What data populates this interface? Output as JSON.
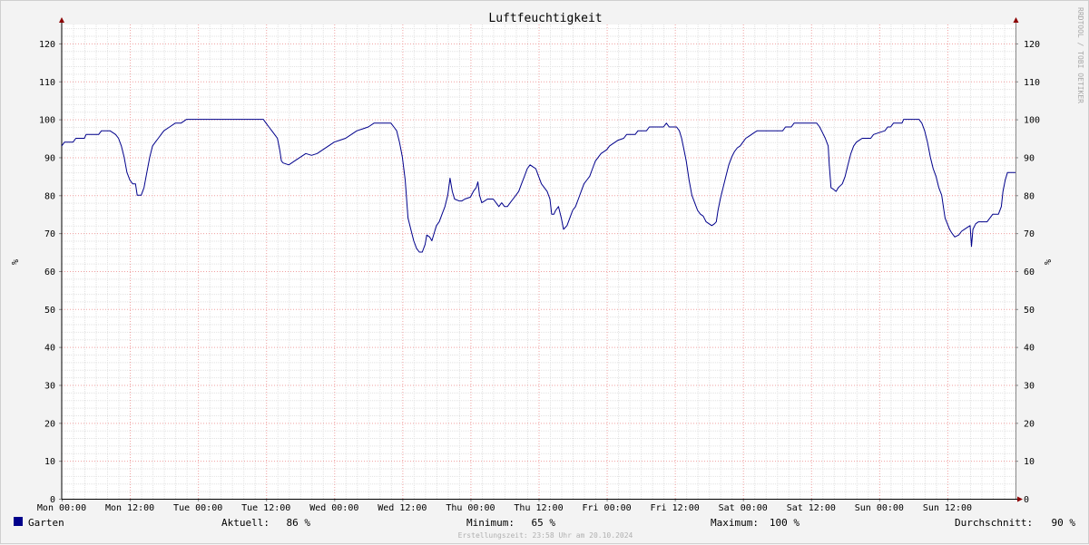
{
  "chart_data": {
    "type": "line",
    "title": "Luftfeuchtigkeit",
    "ylabel": "%",
    "xlabel": "",
    "ylim": [
      0,
      125
    ],
    "xlim": [
      0,
      168
    ],
    "x_unit": "hours since Mon 00:00",
    "y_ticks": [
      0,
      10,
      20,
      30,
      40,
      50,
      60,
      70,
      80,
      90,
      100,
      110,
      120
    ],
    "x_ticks": [
      {
        "x": 0,
        "label": "Mon 00:00"
      },
      {
        "x": 12,
        "label": "Mon 12:00"
      },
      {
        "x": 24,
        "label": "Tue 00:00"
      },
      {
        "x": 36,
        "label": "Tue 12:00"
      },
      {
        "x": 48,
        "label": "Wed 00:00"
      },
      {
        "x": 60,
        "label": "Wed 12:00"
      },
      {
        "x": 72,
        "label": "Thu 00:00"
      },
      {
        "x": 84,
        "label": "Thu 12:00"
      },
      {
        "x": 96,
        "label": "Fri 00:00"
      },
      {
        "x": 108,
        "label": "Fri 12:00"
      },
      {
        "x": 120,
        "label": "Sat 00:00"
      },
      {
        "x": 132,
        "label": "Sat 12:00"
      },
      {
        "x": 144,
        "label": "Sun 00:00"
      },
      {
        "x": 156,
        "label": "Sun 12:00"
      }
    ],
    "grid": true,
    "legend": "bottom-left",
    "series": [
      {
        "name": "Garten",
        "color": "#00008b",
        "points": [
          [
            0,
            93
          ],
          [
            0.5,
            94
          ],
          [
            2,
            94
          ],
          [
            2.5,
            95
          ],
          [
            4,
            95
          ],
          [
            4.3,
            96
          ],
          [
            6.5,
            96
          ],
          [
            7,
            97
          ],
          [
            8.5,
            97
          ],
          [
            9.5,
            96
          ],
          [
            10,
            95
          ],
          [
            10.5,
            93
          ],
          [
            11,
            90
          ],
          [
            11.5,
            86
          ],
          [
            12,
            84
          ],
          [
            12.5,
            83
          ],
          [
            13,
            83
          ],
          [
            13.3,
            80
          ],
          [
            14,
            80
          ],
          [
            14.5,
            82
          ],
          [
            15,
            86
          ],
          [
            15.5,
            90
          ],
          [
            16,
            93
          ],
          [
            16.5,
            94
          ],
          [
            17,
            95
          ],
          [
            17.5,
            96
          ],
          [
            18,
            97
          ],
          [
            19,
            98
          ],
          [
            20,
            99
          ],
          [
            21,
            99
          ],
          [
            22,
            100
          ],
          [
            35,
            100
          ],
          [
            35.5,
            100
          ],
          [
            36,
            99
          ],
          [
            36.5,
            98
          ],
          [
            37,
            97
          ],
          [
            37.5,
            96
          ],
          [
            38,
            95
          ],
          [
            38.4,
            92
          ],
          [
            38.7,
            89
          ],
          [
            39,
            88.5
          ],
          [
            40,
            88
          ],
          [
            40.5,
            88.5
          ],
          [
            41,
            89
          ],
          [
            42,
            90
          ],
          [
            43,
            91
          ],
          [
            44,
            90.5
          ],
          [
            45,
            91
          ],
          [
            46,
            92
          ],
          [
            47,
            93
          ],
          [
            48,
            94
          ],
          [
            49,
            94.5
          ],
          [
            50,
            95
          ],
          [
            51,
            96
          ],
          [
            52,
            97
          ],
          [
            53,
            97.5
          ],
          [
            54,
            98
          ],
          [
            55,
            99
          ],
          [
            56,
            99
          ],
          [
            57,
            99
          ],
          [
            58,
            99
          ],
          [
            58.5,
            98
          ],
          [
            59,
            97
          ],
          [
            59.5,
            94
          ],
          [
            60,
            90
          ],
          [
            60.5,
            84
          ],
          [
            61,
            74
          ],
          [
            61.5,
            71
          ],
          [
            62,
            68
          ],
          [
            62.5,
            66
          ],
          [
            63,
            65
          ],
          [
            63.5,
            65
          ],
          [
            64,
            67
          ],
          [
            64.3,
            69.5
          ],
          [
            64.8,
            69
          ],
          [
            65.2,
            68
          ],
          [
            65.6,
            70
          ],
          [
            66,
            72
          ],
          [
            66.5,
            73
          ],
          [
            67,
            75
          ],
          [
            67.5,
            77
          ],
          [
            68,
            80
          ],
          [
            68.4,
            84.5
          ],
          [
            68.8,
            81
          ],
          [
            69.2,
            79
          ],
          [
            70,
            78.5
          ],
          [
            70.5,
            78.5
          ],
          [
            71,
            79
          ],
          [
            72,
            79.5
          ],
          [
            72.5,
            81
          ],
          [
            73,
            82
          ],
          [
            73.3,
            83.5
          ],
          [
            73.6,
            80
          ],
          [
            74,
            78
          ],
          [
            74.5,
            78.5
          ],
          [
            75,
            79
          ],
          [
            76,
            79
          ],
          [
            76.5,
            78
          ],
          [
            77,
            77
          ],
          [
            77.5,
            78
          ],
          [
            78,
            77
          ],
          [
            78.5,
            77
          ],
          [
            79,
            78
          ],
          [
            79.5,
            79
          ],
          [
            80,
            80
          ],
          [
            80.5,
            81
          ],
          [
            81,
            83
          ],
          [
            81.5,
            85
          ],
          [
            82,
            87
          ],
          [
            82.5,
            88
          ],
          [
            83,
            87.5
          ],
          [
            83.5,
            87
          ],
          [
            84,
            85
          ],
          [
            84.5,
            83
          ],
          [
            85,
            82
          ],
          [
            85.5,
            81
          ],
          [
            86,
            79
          ],
          [
            86.3,
            75
          ],
          [
            86.7,
            75
          ],
          [
            87,
            76
          ],
          [
            87.5,
            77
          ],
          [
            88,
            74
          ],
          [
            88.4,
            71
          ],
          [
            89,
            72
          ],
          [
            89.5,
            74
          ],
          [
            90,
            76
          ],
          [
            90.5,
            77
          ],
          [
            91,
            79
          ],
          [
            91.5,
            81
          ],
          [
            92,
            83
          ],
          [
            92.5,
            84
          ],
          [
            93,
            85
          ],
          [
            93.5,
            87
          ],
          [
            94,
            89
          ],
          [
            94.5,
            90
          ],
          [
            95,
            91
          ],
          [
            96,
            92
          ],
          [
            96.5,
            93
          ],
          [
            97,
            93.5
          ],
          [
            98,
            94.5
          ],
          [
            99,
            95
          ],
          [
            99.5,
            96
          ],
          [
            101,
            96
          ],
          [
            101.5,
            97
          ],
          [
            103,
            97
          ],
          [
            103.5,
            98
          ],
          [
            106,
            98
          ],
          [
            106.5,
            99
          ],
          [
            107,
            98
          ],
          [
            108.3,
            98
          ],
          [
            108.8,
            97
          ],
          [
            109.2,
            95
          ],
          [
            109.6,
            92
          ],
          [
            110,
            89
          ],
          [
            110.5,
            84
          ],
          [
            111,
            80
          ],
          [
            111.5,
            78
          ],
          [
            112,
            76
          ],
          [
            112.5,
            75
          ],
          [
            113,
            74.5
          ],
          [
            113.5,
            73
          ],
          [
            114,
            72.5
          ],
          [
            114.5,
            72
          ],
          [
            115,
            72.5
          ],
          [
            115.3,
            73
          ],
          [
            115.6,
            76
          ],
          [
            116,
            79
          ],
          [
            116.5,
            82
          ],
          [
            117,
            85
          ],
          [
            117.5,
            88
          ],
          [
            118,
            90
          ],
          [
            118.5,
            91.5
          ],
          [
            119,
            92.5
          ],
          [
            119.5,
            93
          ],
          [
            120,
            94
          ],
          [
            120.5,
            95
          ],
          [
            121,
            95.5
          ],
          [
            121.5,
            96
          ],
          [
            122,
            96.5
          ],
          [
            122.5,
            97
          ],
          [
            127,
            97
          ],
          [
            127.5,
            98
          ],
          [
            128.5,
            98
          ],
          [
            129,
            99
          ],
          [
            133,
            99
          ],
          [
            133.5,
            98
          ],
          [
            134,
            96.5
          ],
          [
            134.5,
            95
          ],
          [
            135,
            93
          ],
          [
            135.2,
            88
          ],
          [
            135.5,
            82
          ],
          [
            136,
            81.5
          ],
          [
            136.4,
            81
          ],
          [
            136.8,
            82
          ],
          [
            137.5,
            83
          ],
          [
            138,
            85
          ],
          [
            138.5,
            88
          ],
          [
            139,
            91
          ],
          [
            139.5,
            93
          ],
          [
            140,
            94
          ],
          [
            140.5,
            94.5
          ],
          [
            141,
            95
          ],
          [
            142.5,
            95
          ],
          [
            143,
            96
          ],
          [
            144,
            96.5
          ],
          [
            145,
            97
          ],
          [
            145.5,
            98
          ],
          [
            146,
            98
          ],
          [
            146.5,
            99
          ],
          [
            148,
            99
          ],
          [
            148.3,
            100
          ],
          [
            151,
            100
          ],
          [
            151.5,
            99
          ],
          [
            152,
            97
          ],
          [
            152.5,
            94
          ],
          [
            153,
            90
          ],
          [
            153.5,
            87
          ],
          [
            154,
            85
          ],
          [
            154.5,
            82
          ],
          [
            155,
            80
          ],
          [
            155.3,
            77
          ],
          [
            155.6,
            74
          ],
          [
            156,
            72.5
          ],
          [
            156.4,
            71
          ],
          [
            156.8,
            70
          ],
          [
            157.3,
            69
          ],
          [
            158,
            69.5
          ],
          [
            158.5,
            70.5
          ],
          [
            159,
            71
          ],
          [
            159.5,
            71.5
          ],
          [
            160,
            72
          ],
          [
            160.25,
            66.5
          ],
          [
            160.5,
            71
          ],
          [
            161,
            72.5
          ],
          [
            161.5,
            73
          ],
          [
            162,
            73
          ],
          [
            163,
            73
          ],
          [
            163.5,
            74
          ],
          [
            164,
            75
          ],
          [
            165,
            75
          ],
          [
            165.5,
            77
          ],
          [
            165.8,
            81
          ],
          [
            166.2,
            84
          ],
          [
            166.6,
            86
          ],
          [
            168,
            86
          ]
        ]
      }
    ]
  },
  "stats": {
    "current_label": "Aktuell:",
    "current_value": "86 %",
    "min_label": "Minimum:",
    "min_value": "65 %",
    "max_label": "Maximum:",
    "max_value": "100 %",
    "avg_label": "Durchschnitt:",
    "avg_value": "90 %"
  },
  "watermark": "RRDTOOL / TOBI OETIKER",
  "footer": "Erstellungszeit: 23:58 Uhr am 20.10.2024"
}
